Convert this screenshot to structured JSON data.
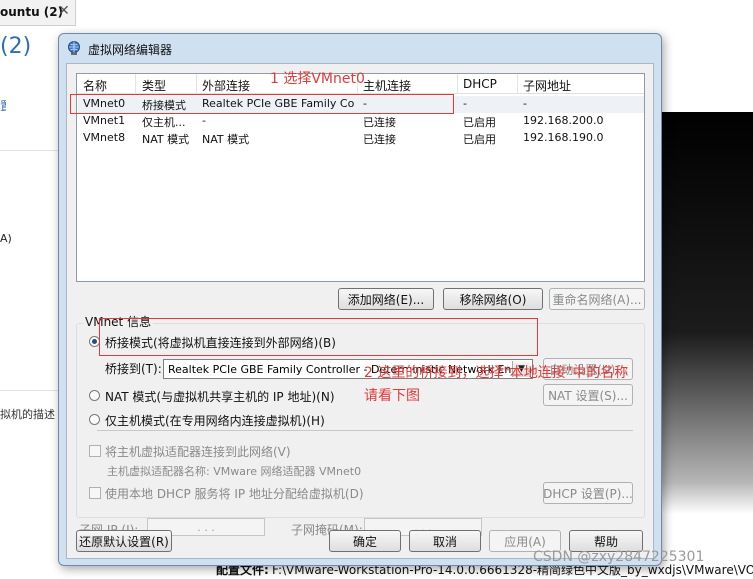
{
  "background": {
    "tab_title": "ountu (2)",
    "tab_close": "✕",
    "header": "(2)",
    "link_fragment": "置",
    "text_a": "A)",
    "desc_fragment": "拟机的描述",
    "bottom_label": "配置文件:",
    "bottom_path": "F:\\VMware-Workstation-Pro-14.0.0.6661328-精简绿色中文版_by_wxdjs\\VMware\\VOS"
  },
  "watermark": "CSDN @zxy2847225301",
  "dialog": {
    "title": "虚拟网络编辑器",
    "columns": [
      "名称",
      "类型",
      "外部连接",
      "主机连接",
      "DHCP",
      "子网地址"
    ],
    "rows": [
      {
        "name": "VMnet0",
        "type": "桥接模式",
        "external": "Realtek PCIe GBE Family Co...",
        "host": "-",
        "dhcp": "-",
        "subnet": "-"
      },
      {
        "name": "VMnet1",
        "type": "仅主机...",
        "external": "-",
        "host": "已连接",
        "dhcp": "已启用",
        "subnet": "192.168.200.0"
      },
      {
        "name": "VMnet8",
        "type": "NAT 模式",
        "external": "NAT 模式",
        "host": "已连接",
        "dhcp": "已启用",
        "subnet": "192.168.190.0"
      }
    ],
    "add_network": "添加网络(E)...",
    "remove_network": "移除网络(O)",
    "rename_network": "重命名网络(A)...",
    "vmnet_info": "VMnet 信息",
    "bridge_mode": "桥接模式(将虚拟机直接连接到外部网络)(B)",
    "bridge_to_label": "桥接到(T):",
    "bridge_to_value": "Realtek PCIe GBE Family Controller - Deterministic Network Enhancer Min",
    "auto_settings": "自动设置(U)...",
    "nat_mode": "NAT 模式(与虚拟机共享主机的 IP 地址)(N)",
    "nat_settings": "NAT 设置(S)...",
    "host_only": "仅主机模式(在专用网络内连接虚拟机)(H)",
    "connect_adapter": "将主机虚拟适配器连接到此网络(V)",
    "adapter_name": "主机虚拟适配器名称: VMware 网络适配器 VMnet0",
    "use_dhcp": "使用本地 DHCP 服务将 IP 地址分配给虚拟机(D)",
    "dhcp_settings": "DHCP 设置(P)...",
    "subnet_ip_label": "子网 IP (I):",
    "subnet_mask_label": "子网掩码(M):",
    "ip_dots": ". . .",
    "restore_defaults": "还原默认设置(R)",
    "ok": "确定",
    "cancel": "取消",
    "apply": "应用(A)",
    "help": "帮助"
  },
  "annotations": {
    "step1": "1 选择VMnet0",
    "step2_line1": "2 这里的桥接到，选择\"本地连接\"中的名称",
    "step2_line2": "请看下图"
  },
  "colors": {
    "annotation": "#e03a3a",
    "title_bar": "#cfe0f1"
  }
}
